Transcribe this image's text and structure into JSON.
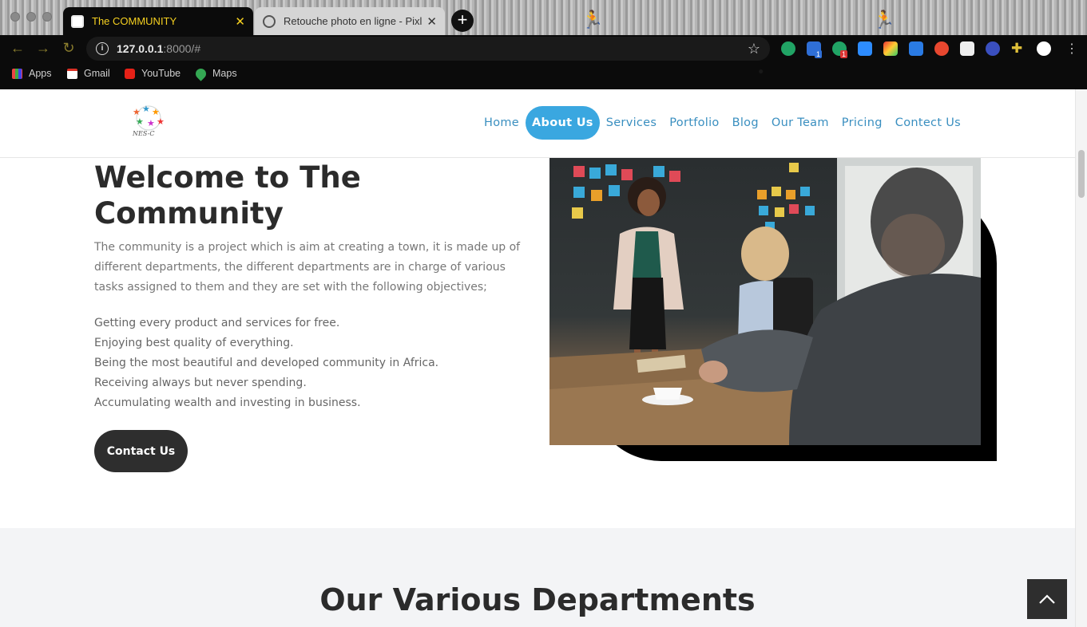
{
  "browser": {
    "tabs": [
      {
        "title": "The COMMUNITY",
        "active": true
      },
      {
        "title": "Retouche photo en ligne - Pixlr",
        "active": false
      }
    ],
    "address": {
      "host": "127.0.0.1",
      "rest": ":8000/#"
    },
    "bookmarks": [
      {
        "label": "Apps",
        "icon": "apps-grid-icon"
      },
      {
        "label": "Gmail",
        "icon": "gmail-icon"
      },
      {
        "label": "YouTube",
        "icon": "youtube-icon"
      },
      {
        "label": "Maps",
        "icon": "maps-icon"
      }
    ],
    "extension_badges": [
      "1",
      "1"
    ]
  },
  "header": {
    "logo_text": "NES-C",
    "menu": [
      {
        "label": "Home",
        "active": false
      },
      {
        "label": "About Us",
        "active": true
      },
      {
        "label": "Services",
        "active": false
      },
      {
        "label": "Portfolio",
        "active": false
      },
      {
        "label": "Blog",
        "active": false
      },
      {
        "label": "Our Team",
        "active": false
      },
      {
        "label": "Pricing",
        "active": false
      },
      {
        "label": "Contect Us",
        "active": false
      }
    ]
  },
  "about": {
    "title": "Welcome to The Community",
    "intro": "The community is a project which is aim at creating a town, it is made up of different departments, the different departments are in charge of various tasks assigned to them and they are set with the following objectives;",
    "objectives": [
      "Getting every product and services for free.",
      "Enjoying best quality of everything.",
      "Being the most beautiful and developed community in Africa.",
      "Receiving always but never spending.",
      "Accumulating wealth and investing in business."
    ],
    "button": "Contact Us"
  },
  "departments": {
    "title": "Our Various Departments"
  },
  "colors": {
    "accent": "#3aa7e0",
    "dark": "#2e2e2e",
    "tab_title": "#f5d020"
  }
}
